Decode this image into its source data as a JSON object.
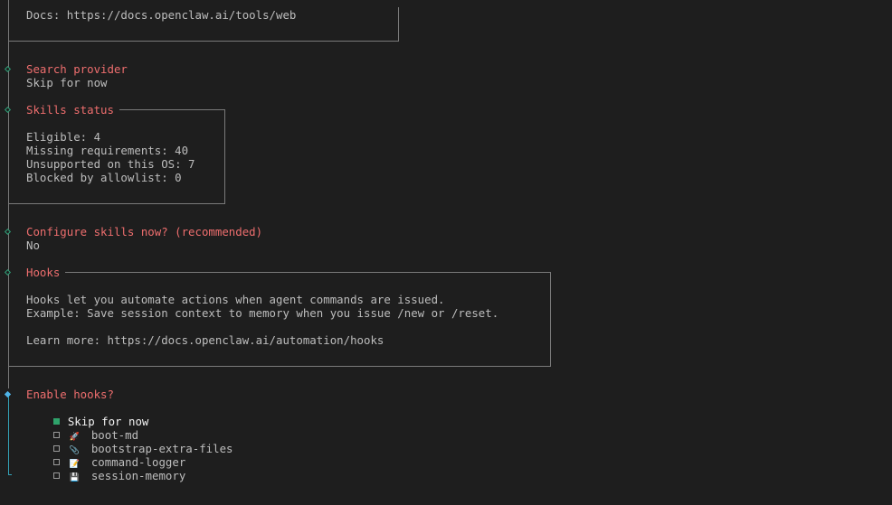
{
  "web_tools": {
    "docs_line": "Docs: https://docs.openclaw.ai/tools/web"
  },
  "search_provider": {
    "title": "Search provider",
    "value": "Skip for now"
  },
  "skills_status": {
    "title": "Skills status",
    "eligible": "Eligible: 4",
    "missing": "Missing requirements: 40",
    "unsupported": "Unsupported on this OS: 7",
    "blocked": "Blocked by allowlist: 0"
  },
  "configure_skills": {
    "title": "Configure skills now? (recommended)",
    "value": "No"
  },
  "hooks_info": {
    "title": "Hooks",
    "line1": "Hooks let you automate actions when agent commands are issued.",
    "line2": "Example: Save session context to memory when you issue /new or /reset.",
    "learn_more": "Learn more: https://docs.openclaw.ai/automation/hooks"
  },
  "enable_hooks": {
    "title": "Enable hooks?",
    "skip_label": "Skip for now",
    "options": [
      {
        "icon": "rocket-icon",
        "glyph": "🚀",
        "label": "boot-md"
      },
      {
        "icon": "paperclip-icon",
        "glyph": "📎",
        "label": "bootstrap-extra-files"
      },
      {
        "icon": "memo-icon",
        "glyph": "📝",
        "label": "command-logger"
      },
      {
        "icon": "floppy-disk-icon",
        "glyph": "💾",
        "label": "session-memory"
      }
    ]
  },
  "colors": {
    "background": "#1e1e1e",
    "text": "#bdbdbd",
    "title": "#ee6e6e",
    "rail": "#7a7a7a",
    "rail_active": "#33a3b8",
    "selected_marker": "#2fa36b"
  }
}
